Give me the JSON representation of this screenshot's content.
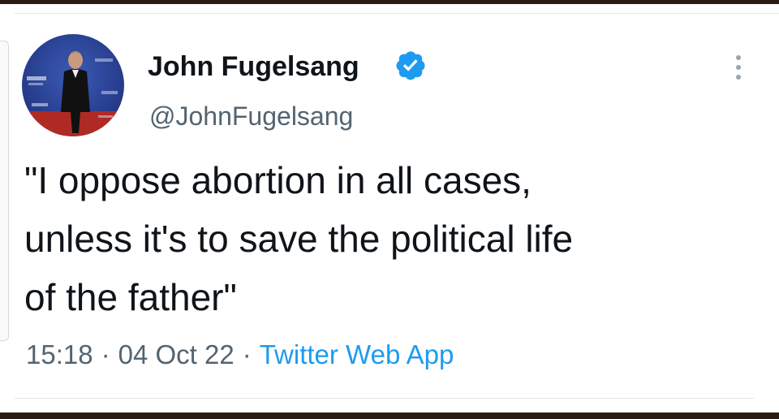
{
  "colors": {
    "text_primary": "#0f1419",
    "text_secondary": "#536471",
    "link": "#1d9bf0",
    "verified": "#1d9bf0"
  },
  "tweet": {
    "author": {
      "display_name": "John Fugelsang",
      "handle": "@JohnFugelsang",
      "verified": true,
      "avatar_icon": "profile-photo"
    },
    "text_lines": [
      "\"I oppose abortion in all cases,",
      "unless it's to save the political life",
      "of the father\""
    ],
    "time": "15:18",
    "date": "04 Oct 22",
    "separator": "·",
    "source": "Twitter Web App",
    "more_icon": "more-vertical-icon"
  }
}
